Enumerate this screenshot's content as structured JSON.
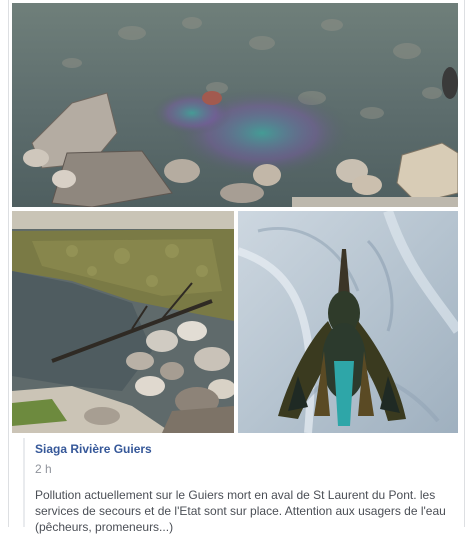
{
  "post": {
    "author": "Siaga Rivière Guiers",
    "time": "2 h",
    "text": "Pollution actuellement sur le Guiers mort en aval de St Laurent du Pont. les services de secours et de l'Etat sont sur place. Attention aux usagers de l'eau (pêcheurs, promeneurs...)"
  },
  "photos": [
    {
      "subject": "river-bed-with-oil-sheen"
    },
    {
      "subject": "polluted-riverbank"
    },
    {
      "subject": "dead-oiled-bird-on-denim"
    }
  ],
  "colors": {
    "link": "#365899",
    "meta": "#90949c",
    "body_text": "#4b4f56",
    "border": "#dddfe2"
  }
}
